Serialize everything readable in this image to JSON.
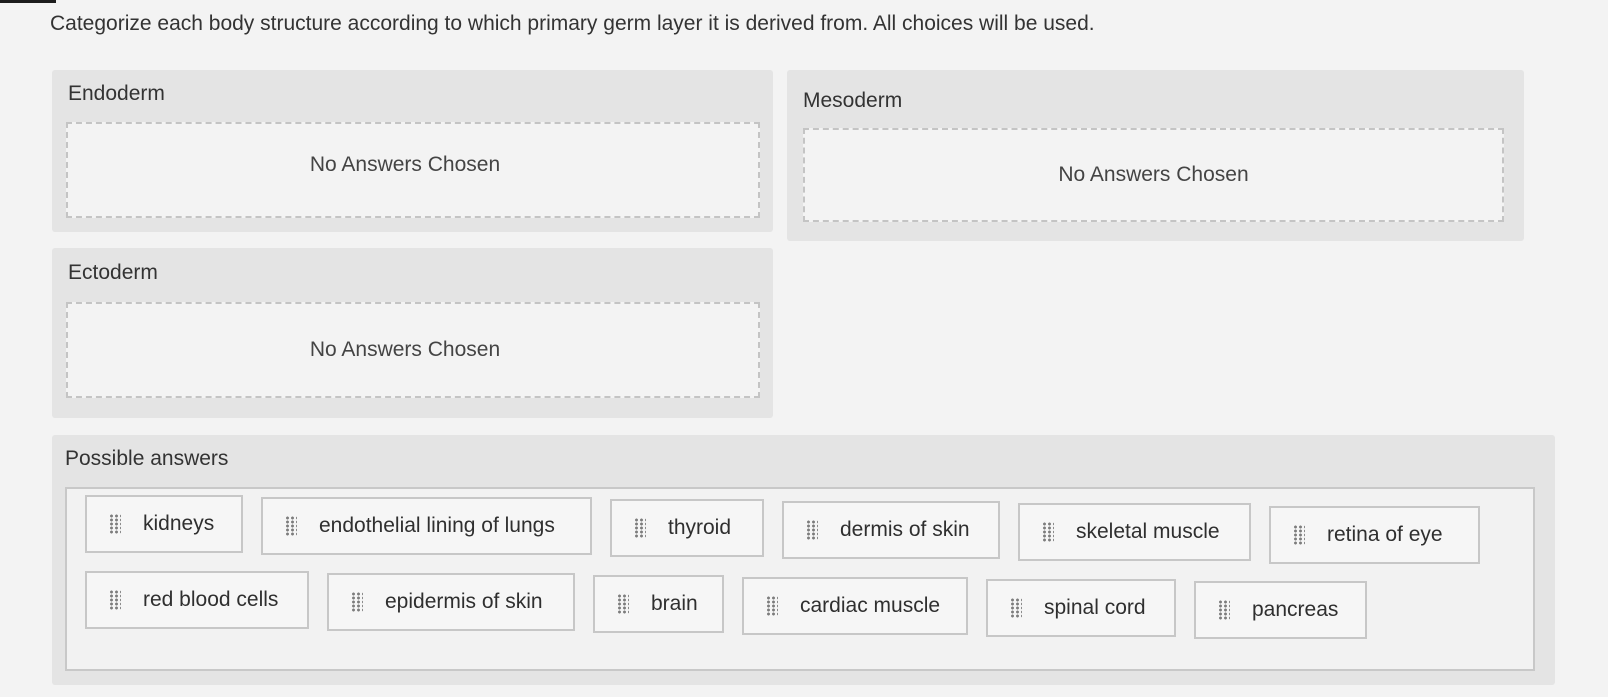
{
  "instruction": "Categorize each body structure according to which primary germ layer it is derived from. All choices will be used.",
  "categories": [
    {
      "title": "Endoderm",
      "empty_text": "No Answers Chosen"
    },
    {
      "title": "Mesoderm",
      "empty_text": "No Answers Chosen"
    },
    {
      "title": "Ectoderm",
      "empty_text": "No Answers Chosen"
    }
  ],
  "answers": {
    "title": "Possible answers",
    "items": [
      {
        "label": "kidneys",
        "icon": "drag-handle-icon"
      },
      {
        "label": "endothelial lining of lungs",
        "icon": "drag-handle-icon"
      },
      {
        "label": "thyroid",
        "icon": "drag-handle-icon"
      },
      {
        "label": "dermis of skin",
        "icon": "drag-handle-icon"
      },
      {
        "label": "skeletal muscle",
        "icon": "drag-handle-icon"
      },
      {
        "label": "retina of eye",
        "icon": "drag-handle-icon"
      },
      {
        "label": "red blood cells",
        "icon": "drag-handle-icon"
      },
      {
        "label": "epidermis of skin",
        "icon": "drag-handle-icon"
      },
      {
        "label": "brain",
        "icon": "drag-handle-icon"
      },
      {
        "label": "cardiac muscle",
        "icon": "drag-handle-icon"
      },
      {
        "label": "spinal cord",
        "icon": "drag-handle-icon"
      },
      {
        "label": "pancreas",
        "icon": "drag-handle-icon"
      }
    ]
  }
}
